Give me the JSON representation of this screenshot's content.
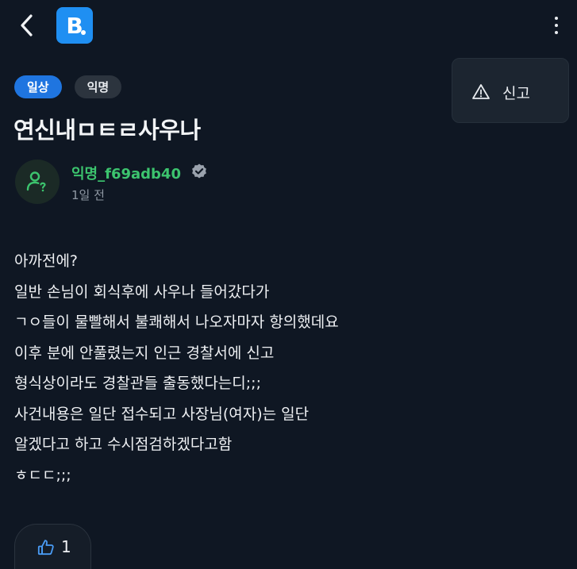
{
  "header": {
    "logo_text": "B",
    "back_icon": "chevron-left-icon",
    "more_icon": "more-vertical-icon",
    "brand_color": "#1f8ff2"
  },
  "menu": {
    "items": [
      {
        "label": "신고",
        "icon": "warning-icon"
      }
    ]
  },
  "post": {
    "tags": [
      "일상",
      "익명"
    ],
    "title": "연신내ㅁㅌㄹ사우나",
    "author": {
      "name": "익명_f69adb40",
      "verified": true,
      "avatar_icon": "anonymous-user-icon",
      "name_color": "#3cc46e"
    },
    "time": "1일 전",
    "body": [
      "아까전에?",
      "일반 손님이 회식후에 사우나 들어갔다가",
      "ㄱㅇ들이 물빨해서 불쾌해서 나오자마자 항의했데요",
      "이후 분에 안풀렸는지 인근 경찰서에 신고",
      "형식상이라도 경찰관들 출동했다는디;;;",
      "사건내용은 일단 접수되고 사장님(여자)는 일단",
      "알겠다고 하고 수시점검하겠다고함",
      "ㅎㄷㄷ;;;"
    ]
  },
  "reactions": {
    "like_count": "1",
    "like_icon": "thumbs-up-icon"
  }
}
